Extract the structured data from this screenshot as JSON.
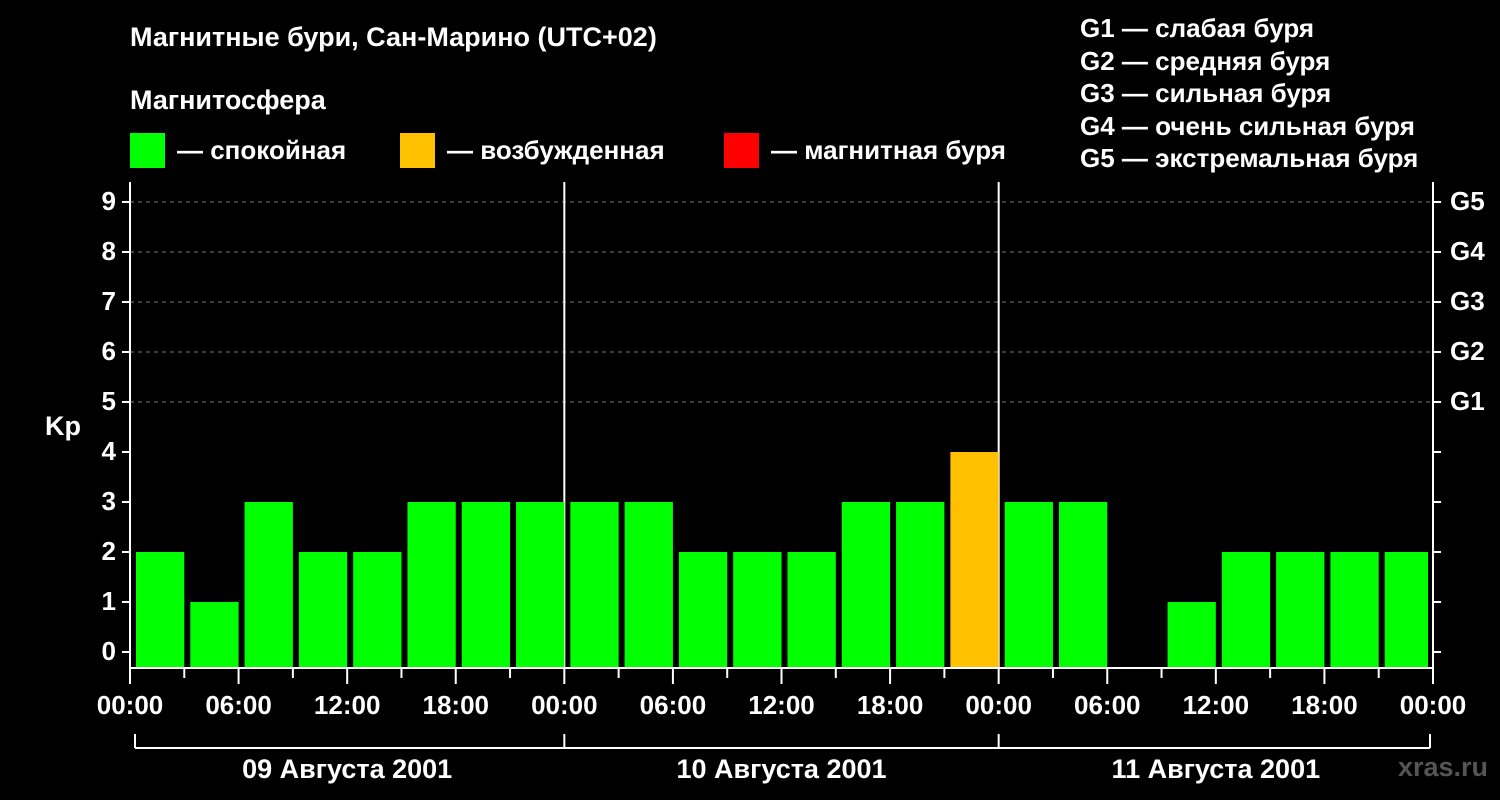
{
  "title": "Магнитные бури, Сан-Марино (UTC+02)",
  "subtitle": "Магнитосфера",
  "legend": [
    {
      "label": "— спокойная",
      "color": "#00ff00"
    },
    {
      "label": "— возбужденная",
      "color": "#ffc000"
    },
    {
      "label": "— магнитная буря",
      "color": "#ff0000"
    }
  ],
  "g_levels": [
    "G1 — слабая буря",
    "G2 — средняя буря",
    "G3 — сильная буря",
    "G4 — очень сильная буря",
    "G5 — экстремальная буря"
  ],
  "watermark": "xras.ru",
  "chart_data": {
    "type": "bar",
    "ylabel": "Kp",
    "ylim": [
      0,
      9
    ],
    "yticks": [
      0,
      1,
      2,
      3,
      4,
      5,
      6,
      7,
      8,
      9
    ],
    "right_labels": [
      {
        "y": 5,
        "label": "G1"
      },
      {
        "y": 6,
        "label": "G2"
      },
      {
        "y": 7,
        "label": "G3"
      },
      {
        "y": 8,
        "label": "G4"
      },
      {
        "y": 9,
        "label": "G5"
      }
    ],
    "grid": true,
    "x_tick_labels": [
      "00:00",
      "06:00",
      "12:00",
      "18:00",
      "00:00",
      "06:00",
      "12:00",
      "18:00",
      "00:00",
      "06:00",
      "12:00",
      "18:00",
      "00:00"
    ],
    "days": [
      "09 Августа 2001",
      "10 Августа 2001",
      "11 Августа 2001"
    ],
    "x_range_hours": [
      0,
      72
    ],
    "bars": [
      {
        "start": "2001-08-09 00:00",
        "end": "2001-08-09 03:00",
        "kp": 2
      },
      {
        "start": "2001-08-09 03:00",
        "end": "2001-08-09 06:00",
        "kp": 1
      },
      {
        "start": "2001-08-09 06:00",
        "end": "2001-08-09 09:00",
        "kp": 3
      },
      {
        "start": "2001-08-09 09:00",
        "end": "2001-08-09 12:00",
        "kp": 2
      },
      {
        "start": "2001-08-09 12:00",
        "end": "2001-08-09 15:00",
        "kp": 2
      },
      {
        "start": "2001-08-09 15:00",
        "end": "2001-08-09 18:00",
        "kp": 3
      },
      {
        "start": "2001-08-09 18:00",
        "end": "2001-08-09 21:00",
        "kp": 3
      },
      {
        "start": "2001-08-09 21:00",
        "end": "2001-08-10 00:00",
        "kp": 3
      },
      {
        "start": "2001-08-10 00:00",
        "end": "2001-08-10 03:00",
        "kp": 3
      },
      {
        "start": "2001-08-10 03:00",
        "end": "2001-08-10 06:00",
        "kp": 3
      },
      {
        "start": "2001-08-10 06:00",
        "end": "2001-08-10 09:00",
        "kp": 2
      },
      {
        "start": "2001-08-10 09:00",
        "end": "2001-08-10 12:00",
        "kp": 2
      },
      {
        "start": "2001-08-10 12:00",
        "end": "2001-08-10 15:00",
        "kp": 2
      },
      {
        "start": "2001-08-10 15:00",
        "end": "2001-08-10 18:00",
        "kp": 3
      },
      {
        "start": "2001-08-10 18:00",
        "end": "2001-08-10 21:00",
        "kp": 3
      },
      {
        "start": "2001-08-10 21:00",
        "end": "2001-08-11 00:00",
        "kp": 4
      },
      {
        "start": "2001-08-11 00:00",
        "end": "2001-08-11 03:00",
        "kp": 3
      },
      {
        "start": "2001-08-11 03:00",
        "end": "2001-08-11 06:00",
        "kp": 3
      },
      {
        "start": "2001-08-11 06:00",
        "end": "2001-08-11 09:00",
        "kp": 0
      },
      {
        "start": "2001-08-11 09:00",
        "end": "2001-08-11 12:00",
        "kp": 1
      },
      {
        "start": "2001-08-11 12:00",
        "end": "2001-08-11 15:00",
        "kp": 2
      },
      {
        "start": "2001-08-11 15:00",
        "end": "2001-08-11 18:00",
        "kp": 2
      },
      {
        "start": "2001-08-11 18:00",
        "end": "2001-08-11 21:00",
        "kp": 2
      },
      {
        "start": "2001-08-11 21:00",
        "end": "2001-08-12 00:00",
        "kp": 2
      }
    ],
    "colors": {
      "quiet": "#00ff00",
      "active": "#ffc000",
      "storm": "#ff0000"
    }
  }
}
